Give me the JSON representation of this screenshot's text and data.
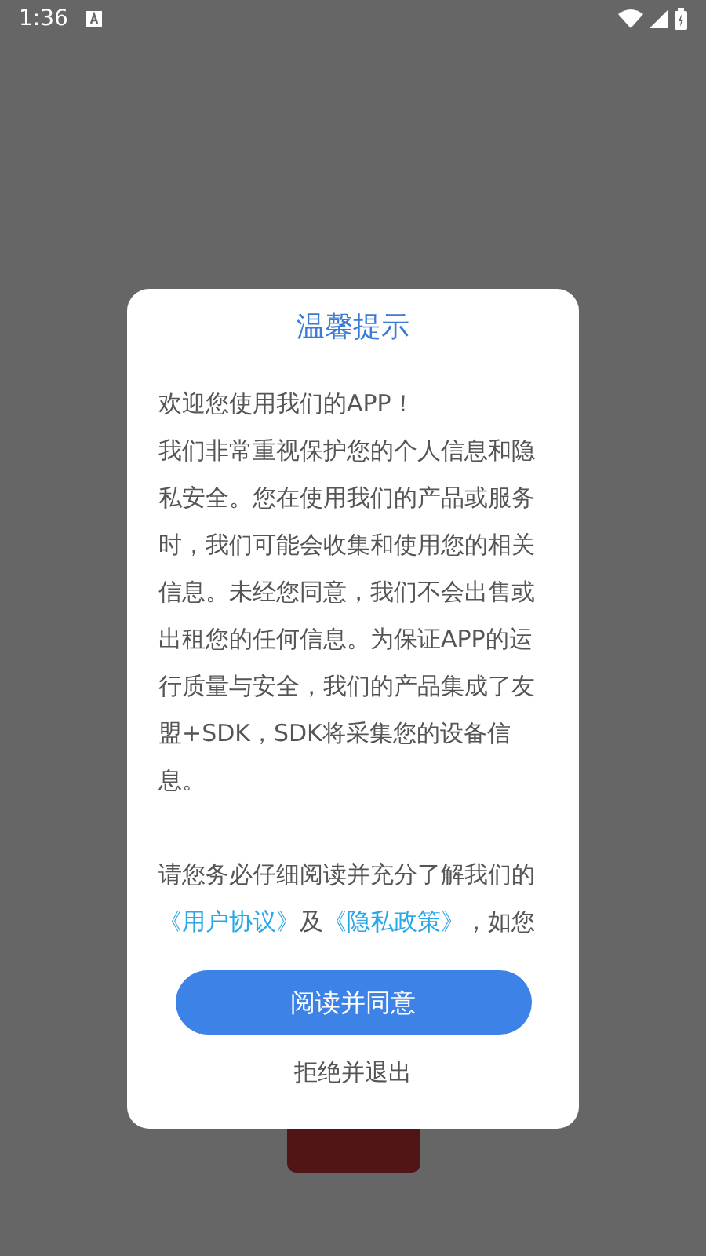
{
  "status_bar": {
    "time": "1:36"
  },
  "dialog": {
    "title": "温馨提示",
    "paragraphs": [
      {
        "segments": [
          {
            "kind": "text",
            "text": "欢迎您使用我们的APP！"
          }
        ]
      },
      {
        "segments": [
          {
            "kind": "text",
            "text": "我们非常重视保护您的个人信息和隐私安全。您在使用我们的产品或服务时，我们可能会收集和使用您的相关信息。未经您同意，我们不会出售或出租您的任何信息。为保证APP的运行质量与安全，我们的产品集成了友盟+SDK，SDK将采集您的设备信息。"
          }
        ]
      },
      {
        "segments": [
          {
            "kind": "text",
            "text": "请您务必仔细阅读并充分了解我们的"
          },
          {
            "kind": "link",
            "text": "《用户协议》"
          },
          {
            "kind": "text",
            "text": "及"
          },
          {
            "kind": "link",
            "text": "《隐私政策》"
          },
          {
            "kind": "text",
            "text": "，如您"
          }
        ]
      }
    ],
    "buttons": [
      {
        "kind": "primary",
        "label": "阅读并同意"
      },
      {
        "kind": "plain",
        "label": "拒绝并退出"
      }
    ]
  }
}
